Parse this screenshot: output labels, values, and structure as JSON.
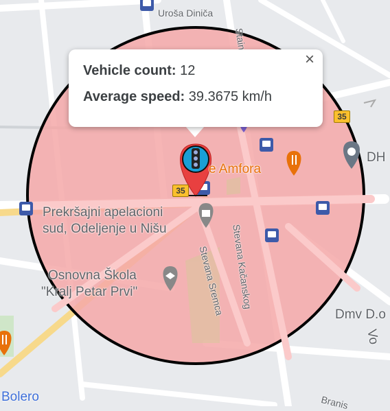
{
  "popup": {
    "vehicle_count_label": "Vehicle count:",
    "vehicle_count_value": "12",
    "avg_speed_label": "Average speed:",
    "avg_speed_value": "39.3675 km/h",
    "close_symbol": "×"
  },
  "map": {
    "streets": {
      "urosa_dinica": "Uroša Diniča",
      "stevana_sremca": "Stevana Sremca",
      "stevana_kacanskog": "Stevana Kačanskog",
      "bolero": "Bolero",
      "dmv": "Dmv D.o",
      "dh": "DH",
      "vo": "Vo",
      "stari": "Staine",
      "bra": "Branis"
    },
    "pois": {
      "amfora": "e Amfora",
      "court_line1": "Prekršajni apelacioni",
      "court_line2": "sud, Odeljenje u Nišu",
      "school_line1": "Osnovna Škola",
      "school_line2": "\"Kralj Petar Prvi\""
    },
    "route_badges": [
      "35",
      "35"
    ],
    "colors": {
      "circle_fill": "#f4a8a8",
      "circle_stroke": "#000000",
      "marker": "#e84040",
      "marker_inner": "#1a9fd6",
      "poi_orange": "#e8710a",
      "transit_blue": "#3d5aa9"
    },
    "icons": [
      "traffic-light-icon",
      "bus-stop-icon",
      "restaurant-icon",
      "landmark-icon",
      "school-icon"
    ]
  }
}
